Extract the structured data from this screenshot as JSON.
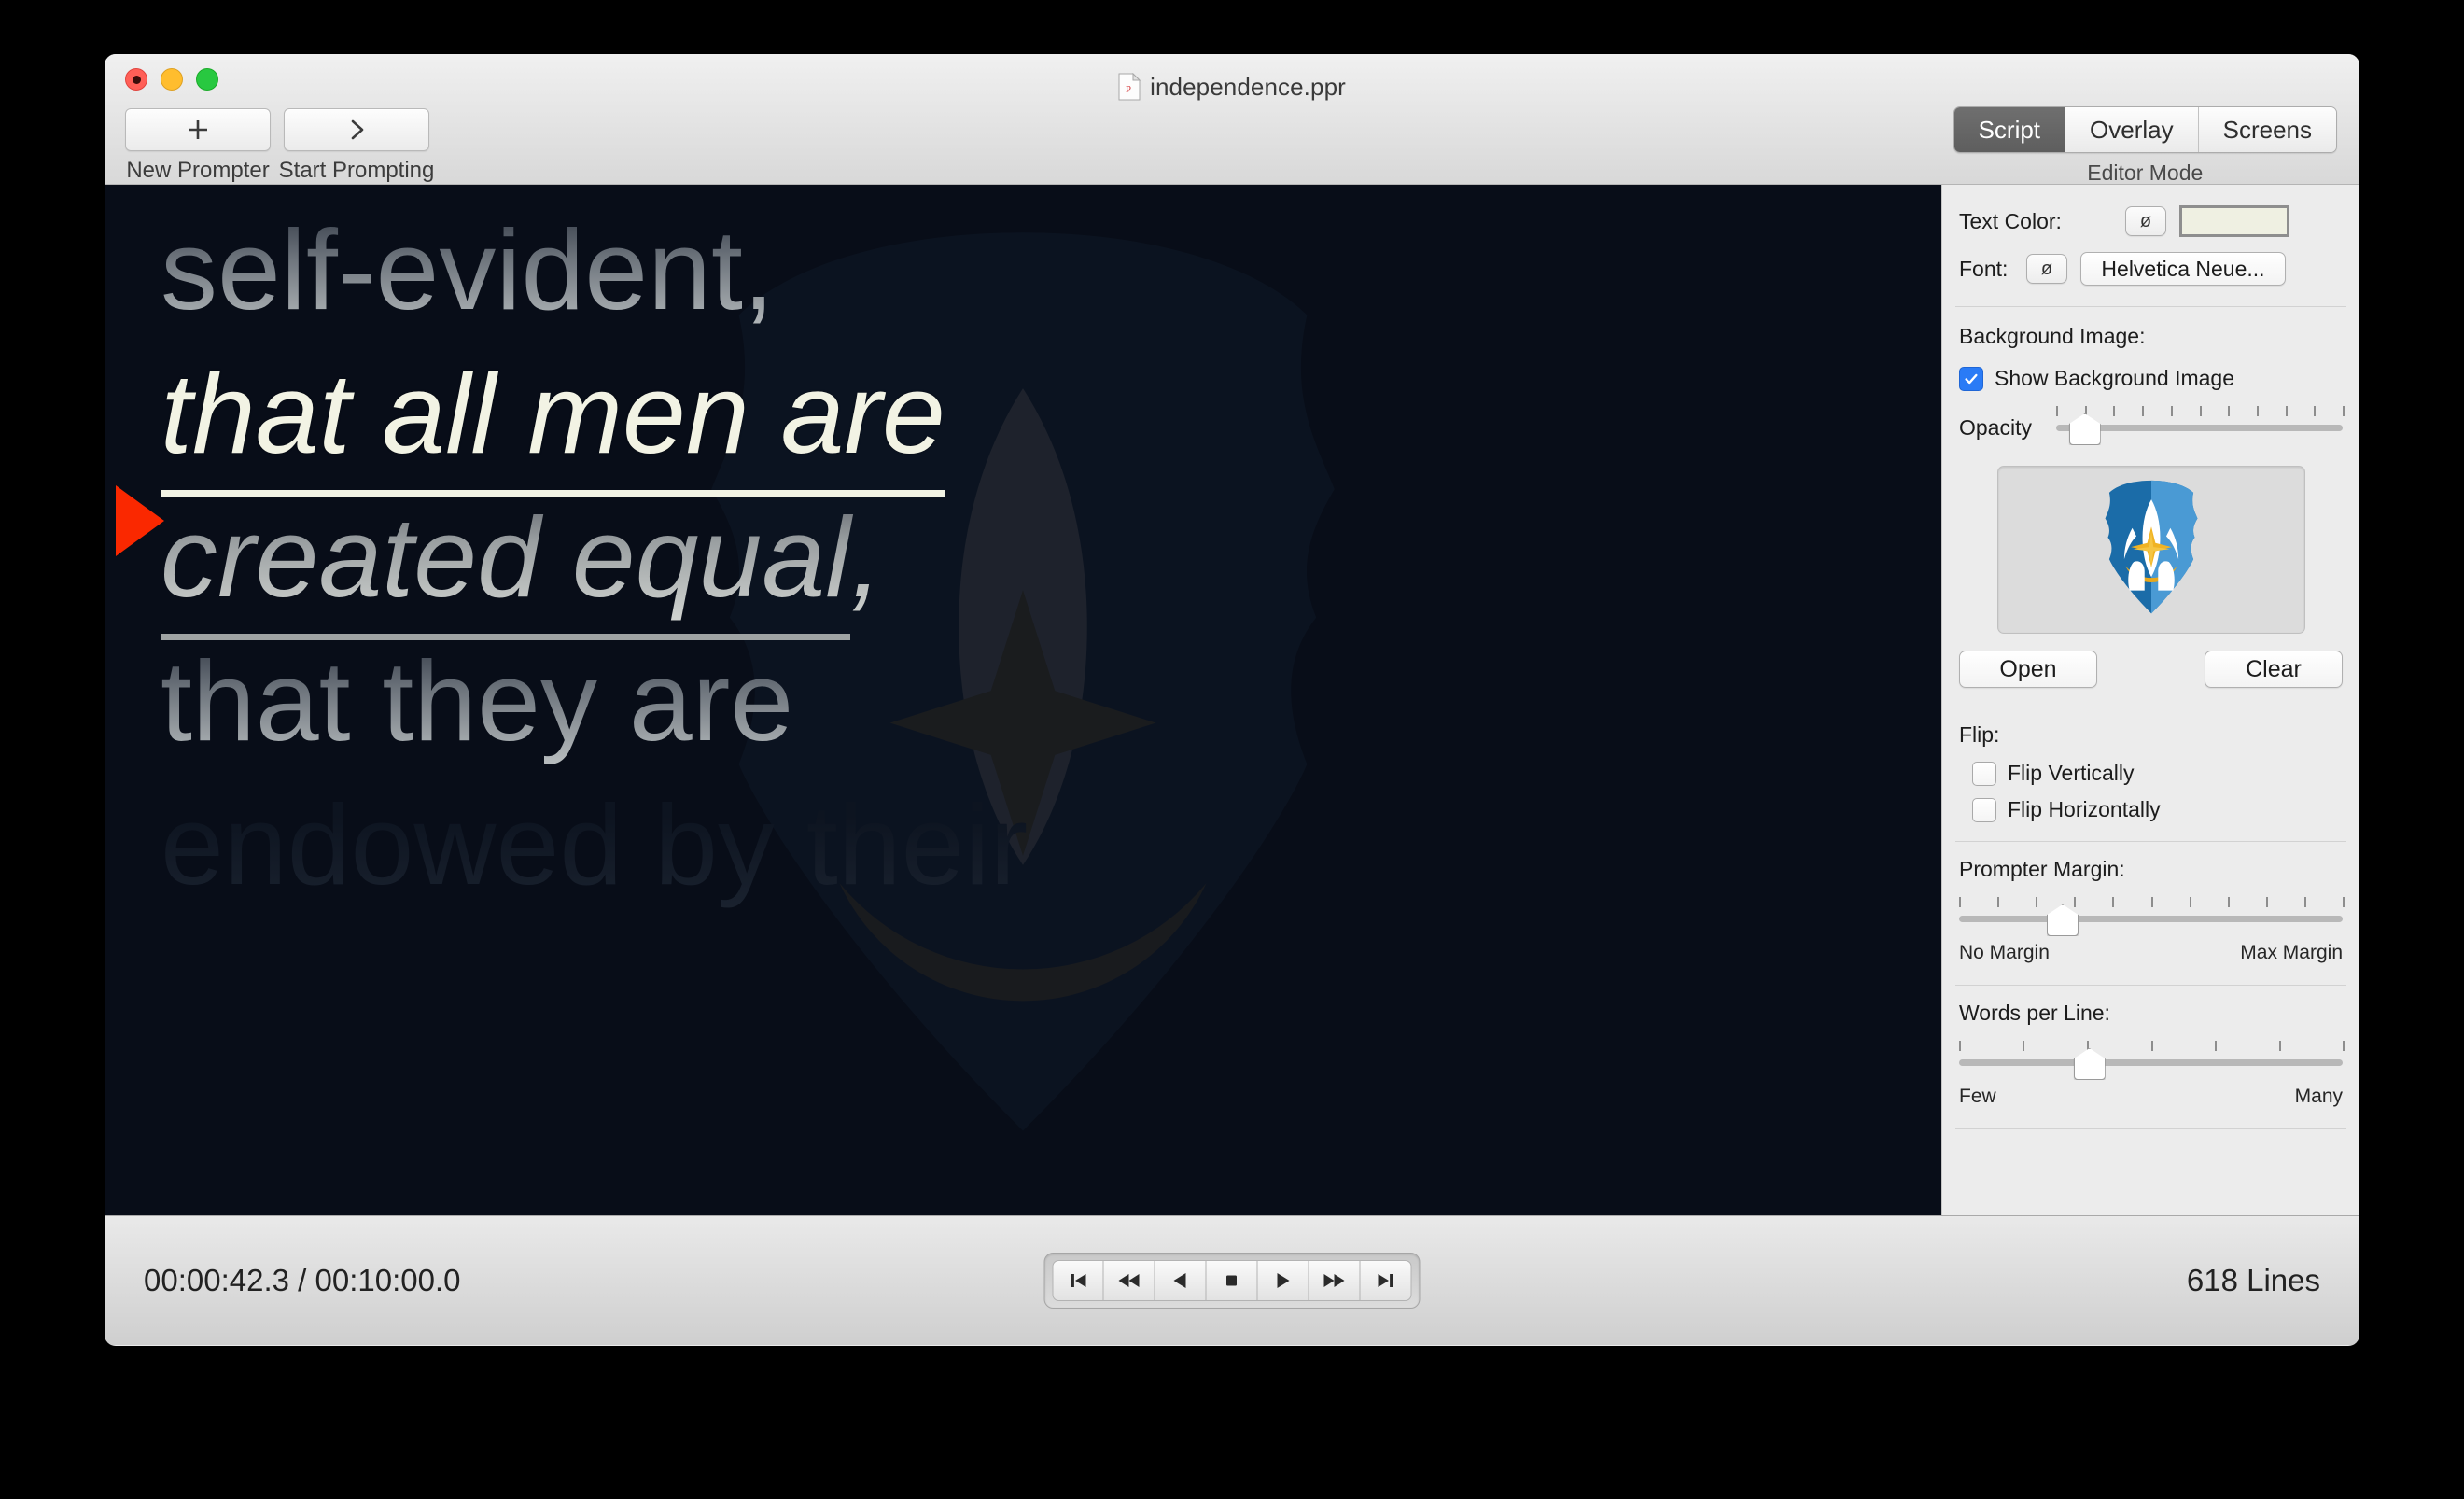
{
  "window": {
    "title": "independence.ppr",
    "doc_icon": "ppr-document-icon",
    "traffic_lights": [
      "close",
      "minimize",
      "zoom"
    ]
  },
  "toolbar": {
    "items": [
      {
        "icon": "plus-icon",
        "label": "New Prompter"
      },
      {
        "icon": "chevron-right-icon",
        "label": "Start Prompting"
      }
    ],
    "editor_mode": {
      "caption": "Editor Mode",
      "segments": [
        "Script",
        "Overlay",
        "Screens"
      ],
      "selected": "Script"
    }
  },
  "prompter": {
    "background_color": "#080d18",
    "cursor_color": "#fa2800",
    "active_text_color": "#f2f3e4",
    "lines": [
      {
        "text": "self-evident,",
        "state": "dim",
        "underline": false
      },
      {
        "text": "that all men are",
        "state": "active",
        "underline": true
      },
      {
        "text": "created equal",
        "trailing": ",",
        "state": "cont",
        "underline": true
      },
      {
        "text": "that they are",
        "state": "dim",
        "underline": false
      },
      {
        "text": "endowed by their",
        "state": "fade",
        "underline": false
      }
    ]
  },
  "inspector": {
    "text_color": {
      "label": "Text Color:",
      "null_button": "ø",
      "swatch_hex": "#eff0e2"
    },
    "font": {
      "label": "Font:",
      "null_button": "ø",
      "value": "Helvetica Neue..."
    },
    "background_image": {
      "label": "Background Image:",
      "show_checkbox": {
        "label": "Show Background Image",
        "checked": true
      },
      "opacity": {
        "label": "Opacity",
        "value_pct": 10,
        "ticks": 11
      },
      "thumbnail_icon": "space-shuttle-shield-emblem",
      "open_button": "Open",
      "clear_button": "Clear"
    },
    "flip": {
      "label": "Flip:",
      "options": [
        {
          "label": "Flip Vertically",
          "checked": false
        },
        {
          "label": "Flip Horizontally",
          "checked": false
        }
      ]
    },
    "prompter_margin": {
      "label": "Prompter Margin:",
      "value_pct": 27,
      "ticks": 11,
      "min_label": "No Margin",
      "max_label": "Max Margin"
    },
    "words_per_line": {
      "label": "Words per Line:",
      "value_pct": 34,
      "ticks": 7,
      "min_label": "Few",
      "max_label": "Many"
    }
  },
  "status_bar": {
    "elapsed": "00:00:42.3",
    "separator": "/",
    "total": "00:10:00.0",
    "timecode": "00:00:42.3 / 00:10:00.0",
    "line_count": "618 Lines",
    "transport": [
      "skip-to-start-icon",
      "rewind-icon",
      "play-reverse-icon",
      "stop-icon",
      "play-icon",
      "fast-forward-icon",
      "skip-to-end-icon"
    ]
  }
}
